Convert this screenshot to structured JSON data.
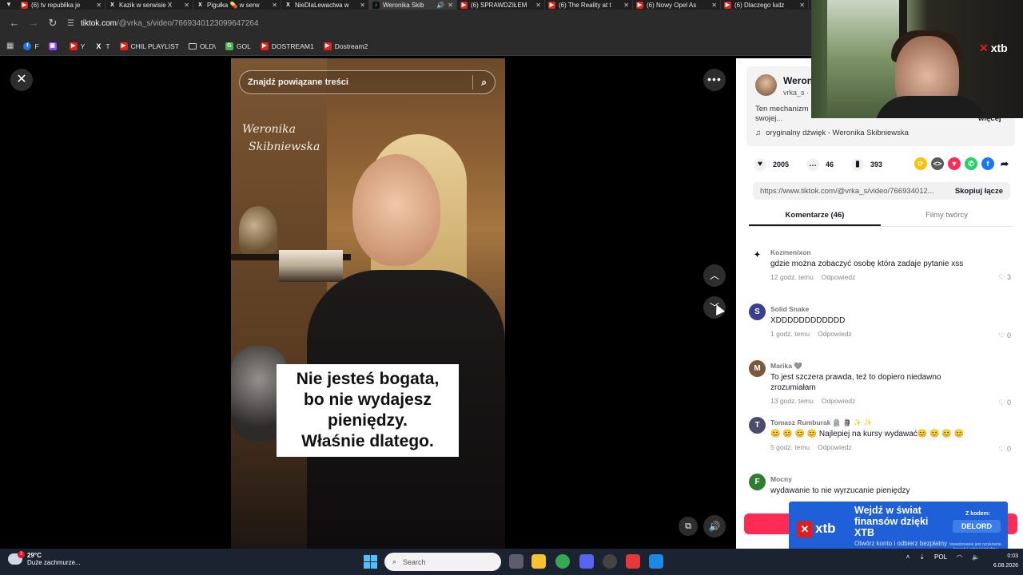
{
  "browser": {
    "tabs": [
      {
        "label": "(6) tv republika je",
        "favicon": "youtube-icon",
        "active": false
      },
      {
        "label": "Kazik w serwisie X",
        "favicon": "x-icon",
        "active": false
      },
      {
        "label": "Pigułka 💊 w serw",
        "favicon": "x-icon",
        "active": false
      },
      {
        "label": "NieDlaLewactwa w",
        "favicon": "x-icon",
        "active": false
      },
      {
        "label": "Weronika Skib",
        "favicon": "tiktok-icon",
        "active": true
      },
      {
        "label": "(6) SPRAWDZIŁEM",
        "favicon": "youtube-icon",
        "active": false
      },
      {
        "label": "(6) The Reality at t",
        "favicon": "youtube-icon",
        "active": false
      },
      {
        "label": "(6) Nowy Opel As",
        "favicon": "youtube-icon",
        "active": false
      },
      {
        "label": "(6) Dlaczego ludz",
        "favicon": "youtube-icon",
        "active": false
      }
    ],
    "url_host": "tiktok.com",
    "url_path": "/@vrka_s/video/7669340123099647264",
    "bookmarks": [
      {
        "label": "F",
        "icon": "facebook-icon"
      },
      {
        "label": "",
        "icon": "twitch-icon"
      },
      {
        "label": "Y",
        "icon": "youtube-icon"
      },
      {
        "label": "T",
        "icon": "x-icon"
      },
      {
        "label": "CHIL PLAYLIST",
        "icon": "youtube-icon"
      },
      {
        "label": "OLD\\",
        "icon": "folder-icon"
      },
      {
        "label": "GOL",
        "icon": "gol-icon"
      },
      {
        "label": "DOSTREAM1",
        "icon": "youtube-icon"
      },
      {
        "label": "Dostream2",
        "icon": "youtube-icon"
      }
    ]
  },
  "video": {
    "search_placeholder": "Znajdź powiązane treści",
    "signature_line1": "Weronika",
    "signature_line2": "Skibniewska",
    "caption": [
      "Nie jesteś bogata,",
      "bo nie wydajesz",
      "pieniędzy.",
      "Właśnie dlatego."
    ]
  },
  "panel": {
    "author_name": "Weron",
    "author_handle": "vrka_s · ",
    "description": "Ten mechanizm ... dużo. On działa już teraz. Jeśli od miesięcy myślisz o swojej...",
    "more_label": "więcej",
    "sound": "oryginalny dźwięk - Weronika Skibniewska",
    "likes": "2005",
    "comments_count": "46",
    "saves": "393",
    "share_link": "https://www.tiktok.com/@vrka_s/video/766934012...",
    "copy_label": "Skopiuj łącze",
    "tab_comments": "Komentarze (46)",
    "tab_creator": "Filmy twórcy"
  },
  "comments": [
    {
      "name": "Kozmenixon",
      "text": "gdzie można zobaczyć osobę która zadaje pytanie xss",
      "time": "12 godz. temu",
      "reply": "Odpowiedz",
      "likes": "3",
      "avatar_color": "#ffffff",
      "avatar_glyph": "✦"
    },
    {
      "name": "Solid Snake",
      "text": "XDDDDDDDDDDDD",
      "time": "1 godz. temu",
      "reply": "Odpowiedz",
      "likes": "0",
      "avatar_color": "#3b3f8f",
      "avatar_glyph": "S"
    },
    {
      "name": "Marika 🩶",
      "text": "To jest szczera prawda, też to dopiero niedawno zrozumiałam",
      "time": "13 godz. temu",
      "reply": "Odpowiedz",
      "likes": "0",
      "avatar_color": "#7a5a3a",
      "avatar_glyph": "M"
    },
    {
      "name": "Tomasz Rumburak 🪦 🗿 ✨ ✨",
      "text": "😊 😊 😊 😊  Najlepiej na kursy wydawać😊 😊 😊 😊",
      "time": "5 godz. temu",
      "reply": "Odpowiedz",
      "likes": "0",
      "avatar_color": "#4b4b6b",
      "avatar_glyph": "T"
    },
    {
      "name": "Mocny",
      "text": "wydawanie to nie wyrzucanie pieniędzy",
      "time": "",
      "reply": "",
      "likes": "",
      "avatar_color": "#2e7d32",
      "avatar_glyph": "F"
    }
  ],
  "webcam": {
    "brand": "xtb"
  },
  "ad": {
    "logo": "xtb",
    "headline": "Wejdź w świat finansów dzięki XTB",
    "sub": "Otwórz konto i odbierz bezpłatny kurs",
    "code_label": "Z kodem:",
    "code": "DELORD",
    "legal": "Inwestowanie jest ryzykowne. Inwestuj odpowiedzialnie."
  },
  "taskbar": {
    "temperature": "29°C",
    "weather_text": "Duże zachmurze...",
    "notification_count": "3",
    "search_placeholder": "Search",
    "language": "POL",
    "time": "0:03",
    "date": "6.08.2026"
  }
}
